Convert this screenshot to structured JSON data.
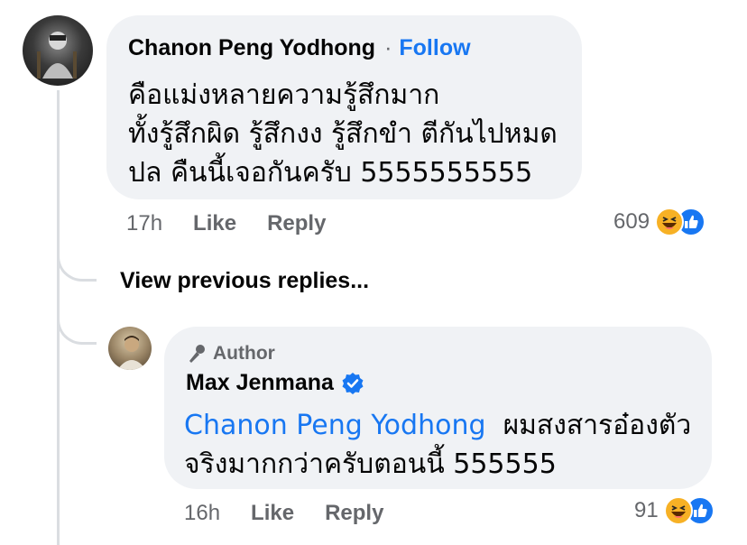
{
  "comment": {
    "author": "Chanon Peng Yodhong",
    "follow_dot": "·",
    "follow_label": "Follow",
    "lines": [
      "คือแม่งหลายความรู้สึกมาก",
      "ทั้งรู้สึกผิด รู้สึกงง รู้สึกขำ ตีกันไปหมด",
      "ปล คืนนี้เจอกันครับ 5555555555"
    ],
    "time": "17h",
    "like_label": "Like",
    "reply_label": "Reply",
    "reaction_count": "609",
    "reaction_icons": [
      "haha-icon",
      "like-icon"
    ]
  },
  "view_previous": "View previous replies...",
  "reply": {
    "badge": "Author",
    "author": "Max Jenmana",
    "verified_icon": "verified-badge-icon",
    "mention": "Chanon Peng Yodhong",
    "text_line1_rest": "ผมสงสารอ๋องตัว",
    "text_line2": "จริงมากกว่าครับตอนนี้ 555555",
    "time": "16h",
    "like_label": "Like",
    "reply_label": "Reply",
    "reaction_count": "91",
    "reaction_icons": [
      "haha-icon",
      "like-icon"
    ]
  },
  "colors": {
    "link": "#1877f2",
    "bubble": "#f0f2f5",
    "secondary_text": "#65676b",
    "haha": "#f7b125",
    "like": "#1877f2"
  }
}
